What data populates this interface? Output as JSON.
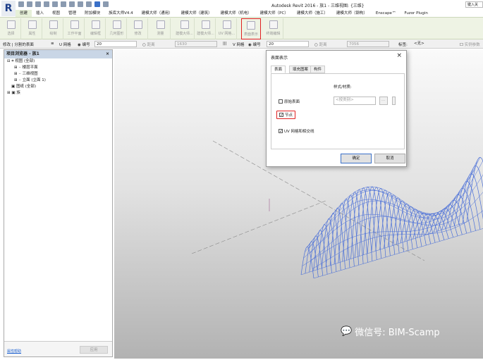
{
  "app_title": "Autodesk Revit 2016 -    族1 - 三维视图: {三维}",
  "search_placeholder": "键入关",
  "menu": [
    "创建",
    "插入",
    "视图",
    "管理",
    "附加模块",
    "族库大师V4.4",
    "建模大师（通用）",
    "建模大师（建筑）",
    "建模大师（机电）",
    "建模大师（PC）",
    "建模大师（施工）",
    "建模大师（钢构）",
    "Enscape™",
    "Fuzor Plugin"
  ],
  "menu_active": "创建",
  "ribbon": [
    "选择",
    "属性",
    "绘制",
    "工作平面",
    "编辑框",
    "几何图形",
    "修改",
    "测量",
    "建模大师...",
    "建模大师...",
    "UV 网格...",
    "表面表示",
    "终端编辑"
  ],
  "ribbon_selected": "表面表示",
  "options": {
    "context": "修改 | 分割的表面",
    "u_grid": "U 网格",
    "number_label": "编号",
    "u_value": "20",
    "distance_label": "距离",
    "u_distance": "1630",
    "v_grid": "V 网格",
    "v_value": "20",
    "v_distance": "7056",
    "tag_label": "标签:",
    "tag_value": "<无>",
    "instance_param": "实例参数"
  },
  "browser": {
    "title": "项目浏览器 - 族1",
    "close": "×",
    "items": [
      "视图 (全部)",
      "楼层平面",
      "三维视图",
      "立面 (立面 1)",
      "图纸 (全部)",
      "族"
    ],
    "properties_help": "属性帮助",
    "apply": "应用"
  },
  "dialog": {
    "title": "表面表示",
    "close": "×",
    "tabs": [
      "表面",
      "填充图案",
      "构件"
    ],
    "style_label": "样式/材质:",
    "style_value": "<按类别>",
    "browse": "...",
    "original_surface": "原始表面",
    "nodes": "节点",
    "uv_grid": "UV 网格和相交线",
    "ok": "确定",
    "cancel": "取消"
  },
  "checks": {
    "original_surface": false,
    "nodes": true,
    "uv_grid": true
  },
  "watermark": "微信号: BIM-Scamp",
  "colors": {
    "mesh": "#4a6fd8",
    "highlight": "#e02020"
  }
}
